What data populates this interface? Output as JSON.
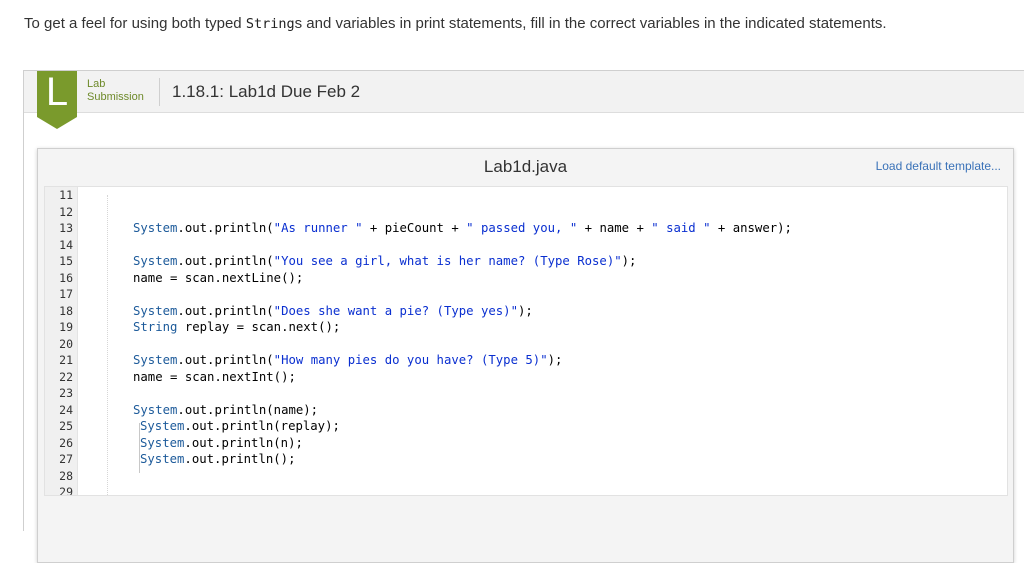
{
  "intro": {
    "before": "To get a feel for using both typed ",
    "code": "String",
    "after": "s and variables in print statements, fill in the correct variables in the indicated statements."
  },
  "lab": {
    "badge_letter": "L",
    "badge_color": "#7a9a2c",
    "type_line1": "Lab",
    "type_line2": "Submission",
    "title": "1.18.1: Lab1d Due Feb 2"
  },
  "editor": {
    "file_name": "Lab1d.java",
    "load_template_label": "Load default template...",
    "line_numbers": [
      "11",
      "12",
      "13",
      "14",
      "15",
      "16",
      "17",
      "18",
      "19",
      "20",
      "21",
      "22",
      "23",
      "24",
      "25",
      "26",
      "27",
      "28",
      "29"
    ],
    "lines": {
      "l13": {
        "obj": "System",
        "mid": ".out.println(",
        "str": "\"As runner \"",
        "p1": " + pieCount + ",
        "str2": "\" passed you, \"",
        "p2": " + name + ",
        "str3": "\" said \"",
        "p3": " + answer);"
      },
      "l15": {
        "obj": "System",
        "mid": ".out.println(",
        "str": "\"You see a girl, what is her name? (Type Rose)\"",
        "end": ");"
      },
      "l16": {
        "text": "name = scan.nextLine();"
      },
      "l18": {
        "obj": "System",
        "mid": ".out.println(",
        "str": "\"Does she want a pie? (Type yes)\"",
        "end": ");"
      },
      "l19": {
        "kw": "String",
        "text": " replay = scan.next();"
      },
      "l21": {
        "obj": "System",
        "mid": ".out.println(",
        "str": "\"How many pies do you have? (Type 5)\"",
        "end": ");"
      },
      "l22": {
        "text": "name = scan.nextInt();"
      },
      "l24": {
        "obj": "System",
        "mid": ".out.println(name);"
      },
      "l25": {
        "obj": "System",
        "mid": ".out.println(replay);"
      },
      "l26": {
        "obj": "System",
        "mid": ".out.println(n);"
      },
      "l27": {
        "obj": "System",
        "mid": ".out.println();"
      }
    }
  }
}
